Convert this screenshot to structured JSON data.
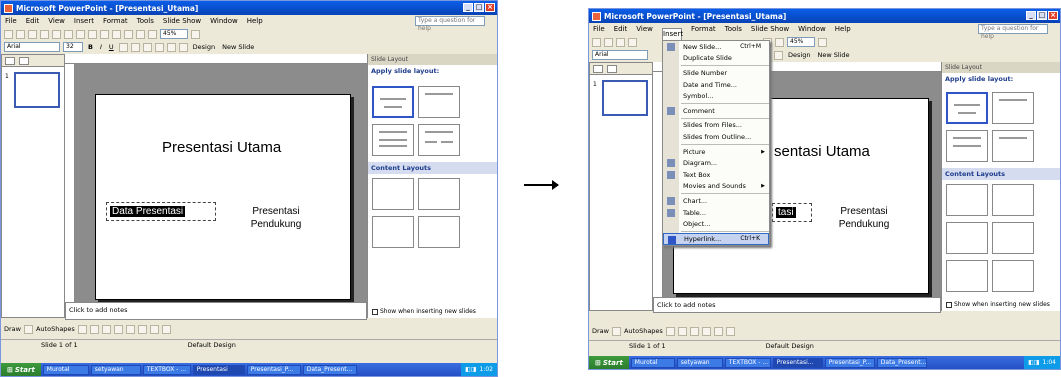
{
  "left": {
    "window_title": "Microsoft PowerPoint - [Presentasi_Utama]",
    "menu": [
      "File",
      "Edit",
      "View",
      "Insert",
      "Format",
      "Tools",
      "Slide Show",
      "Window",
      "Help"
    ],
    "ask_placeholder": "Type a question for help",
    "font_name": "Arial",
    "font_size": "32",
    "zoom": "45%",
    "design_label": "Design",
    "new_slide_label": "New Slide",
    "slide_title": "Presentasi Utama",
    "subtitle_1": "Data Presentasi",
    "subtitle_2_line1": "Presentasi",
    "subtitle_2_line2": "Pendukung",
    "notes": "Click to add notes",
    "task_title": "Slide Layout",
    "apply_label": "Apply slide layout:",
    "content_layouts": "Content Layouts",
    "show_when": "Show when inserting new slides",
    "draw_label": "Draw",
    "autoshapes_label": "AutoShapes",
    "status_slide": "Slide 1 of 1",
    "status_design": "Default Design",
    "start": "Start",
    "tasks": [
      "Murotal",
      "setyawan",
      "TEXTBOX - ...",
      "Presentasi",
      "Presentasi_P...",
      "Data_Present..."
    ],
    "clock": "1:02"
  },
  "right": {
    "window_title": "Microsoft PowerPoint - [Presentasi_Utama]",
    "menu": [
      "File",
      "Edit",
      "View",
      "Insert",
      "Format",
      "Tools",
      "Slide Show",
      "Window",
      "Help"
    ],
    "ask_placeholder": "Type a question for help",
    "font_name": "Arial",
    "zoom": "45%",
    "design_label": "Design",
    "new_slide_label": "New Slide",
    "insert_menu": [
      {
        "label": "New Slide...",
        "shortcut": "Ctrl+M",
        "icon": "new-slide-icon"
      },
      {
        "label": "Duplicate Slide",
        "shortcut": "",
        "icon": ""
      },
      {
        "label": "Slide Number",
        "shortcut": "",
        "icon": ""
      },
      {
        "label": "Date and Time...",
        "shortcut": "",
        "icon": ""
      },
      {
        "label": "Symbol...",
        "shortcut": "",
        "icon": ""
      },
      {
        "label": "Comment",
        "shortcut": "",
        "icon": "comment-icon"
      },
      {
        "label": "Slides from Files...",
        "shortcut": "",
        "icon": ""
      },
      {
        "label": "Slides from Outline...",
        "shortcut": "",
        "icon": ""
      },
      {
        "label": "Picture",
        "shortcut": "",
        "icon": "",
        "submenu": true
      },
      {
        "label": "Diagram...",
        "shortcut": "",
        "icon": "diagram-icon"
      },
      {
        "label": "Text Box",
        "shortcut": "",
        "icon": "textbox-icon"
      },
      {
        "label": "Movies and Sounds",
        "shortcut": "",
        "icon": "",
        "submenu": true
      },
      {
        "label": "Chart...",
        "shortcut": "",
        "icon": "chart-icon"
      },
      {
        "label": "Table...",
        "shortcut": "",
        "icon": "table-icon"
      },
      {
        "label": "Object...",
        "shortcut": "",
        "icon": ""
      },
      {
        "label": "Hyperlink...",
        "shortcut": "Ctrl+K",
        "icon": "hyperlink-icon",
        "highlight": true
      }
    ],
    "slide_title": "sentasi Utama",
    "subtitle_1": "tasi",
    "subtitle_2_line1": "Presentasi",
    "subtitle_2_line2": "Pendukung",
    "notes": "Click to add notes",
    "task_title": "Slide Layout",
    "apply_label": "Apply slide layout:",
    "content_layouts": "Content Layouts",
    "show_when": "Show when inserting new slides",
    "draw_label": "Draw",
    "autoshapes_label": "AutoShapes",
    "status_slide": "Slide 1 of 1",
    "status_design": "Default Design",
    "start": "Start",
    "tasks": [
      "Murotal",
      "setyawan",
      "TEXTBOX - ...",
      "Presentasi...",
      "Presentasi_P...",
      "Data_Present..."
    ],
    "clock": "1:04"
  }
}
